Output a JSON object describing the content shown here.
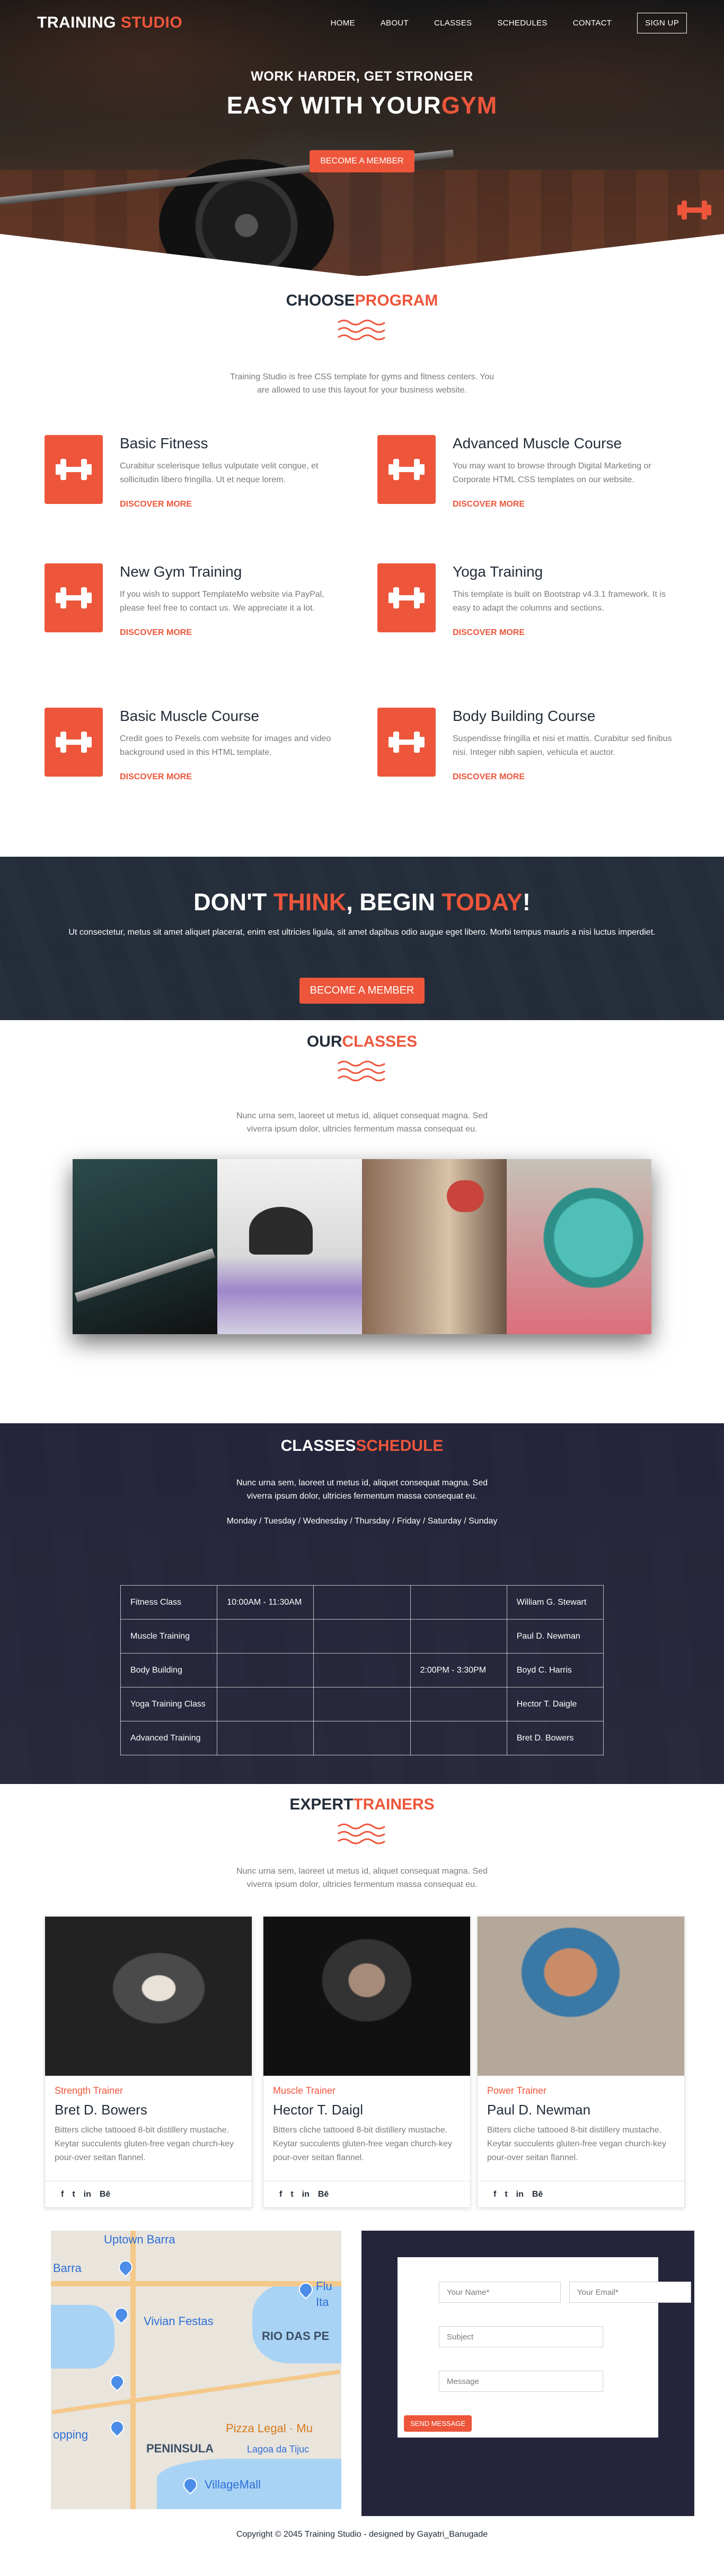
{
  "brand": {
    "name_part1": "TRAINING",
    "name_part2": "STUDIO"
  },
  "nav": {
    "items": [
      "HOME",
      "ABOUT",
      "CLASSES",
      "SCHEDULES",
      "CONTACT"
    ],
    "signup": "SIGN UP"
  },
  "hero": {
    "subtitle": "WORK HARDER, GET STRONGER",
    "title_part1": "EASY WITH YOUR",
    "title_part2": "GYM",
    "button": "BECOME A MEMBER"
  },
  "programs": {
    "title_part1": "CHOOSE",
    "title_part2": "PROGRAM",
    "desc": "Training Studio is free CSS template for gyms and fitness centers. You are allowed to use this layout for your business website.",
    "items": [
      {
        "title": "Basic Fitness",
        "text": "Curabitur scelerisque tellus vulputate velit congue, et sollicitudin libero fringilla. Ut et neque lorem.",
        "link": "DISCOVER MORE"
      },
      {
        "title": "Advanced Muscle Course",
        "text": "You may want to browse through Digital Marketing or Corporate HTML CSS templates on our website.",
        "link": "DISCOVER MORE"
      },
      {
        "title": "New Gym Training",
        "text": "If you wish to support TemplateMo website via PayPal, please feel free to contact us. We appreciate it a lot.",
        "link": "DISCOVER MORE"
      },
      {
        "title": "Yoga Training",
        "text": "This template is built on Bootstrap v4.3.1 framework. It is easy to adapt the columns and sections.",
        "link": "DISCOVER MORE"
      },
      {
        "title": "Basic Muscle Course",
        "text": "Credit goes to Pexels.com website for images and video background used in this HTML template.",
        "link": "DISCOVER MORE"
      },
      {
        "title": "Body Building Course",
        "text": "Suspendisse fringilla et nisi et mattis. Curabitur sed finibus nisi. Integer nibh sapien, vehicula et auctor.",
        "link": "DISCOVER MORE"
      }
    ]
  },
  "cta": {
    "title_a": "DON'T ",
    "title_b": "THINK",
    "title_c": ", BEGIN ",
    "title_d": "TODAY",
    "title_e": "!",
    "text": "Ut consectetur, metus sit amet aliquet placerat, enim est ultricies ligula, sit amet dapibus odio augue eget libero. Morbi tempus mauris a nisi luctus imperdiet.",
    "button": "BECOME A MEMBER"
  },
  "classes": {
    "title_part1": "OUR",
    "title_part2": "CLASSES",
    "desc": "Nunc urna sem, laoreet ut metus id, aliquet consequat magna. Sed viverra ipsum dolor, ultricies fermentum massa consequat eu."
  },
  "schedule": {
    "title_part1": "CLASSES",
    "title_part2": "SCHEDULE",
    "desc": "Nunc urna sem, laoreet ut metus id, aliquet consequat magna. Sed viverra ipsum dolor, ultricies fermentum massa consequat eu.",
    "days": "Monday / Tuesday / Wednesday / Thursday / Friday / Saturday / Sunday",
    "rows": [
      [
        "Fitness Class",
        "10:00AM - 11:30AM",
        "",
        "",
        "William G. Stewart"
      ],
      [
        "Muscle Training",
        "",
        "",
        "",
        "Paul D. Newman"
      ],
      [
        "Body Building",
        "",
        "",
        "2:00PM - 3:30PM",
        "Boyd C. Harris"
      ],
      [
        "Yoga Training Class",
        "",
        "",
        "",
        "Hector T. Daigle"
      ],
      [
        "Advanced Training",
        "",
        "",
        "",
        "Bret D. Bowers"
      ]
    ]
  },
  "trainers": {
    "title_part1": "EXPERT",
    "title_part2": "TRAINERS",
    "desc": "Nunc urna sem, laoreet ut metus id, aliquet consequat magna. Sed viverra ipsum dolor, ultricies fermentum massa consequat eu.",
    "items": [
      {
        "role": "Strength Trainer",
        "name": "Bret D. Bowers",
        "bio": "Bitters cliche tattooed 8-bit distillery mustache. Keytar succulents gluten-free vegan church-key pour-over seitan flannel."
      },
      {
        "role": "Muscle Trainer",
        "name": "Hector T. Daigl",
        "bio": "Bitters cliche tattooed 8-bit distillery mustache. Keytar succulents gluten-free vegan church-key pour-over seitan flannel."
      },
      {
        "role": "Power Trainer",
        "name": "Paul D. Newman",
        "bio": "Bitters cliche tattooed 8-bit distillery mustache. Keytar succulents gluten-free vegan church-key pour-over seitan flannel."
      }
    ],
    "social": [
      "f",
      "t",
      "in",
      "Bē"
    ]
  },
  "map": {
    "labels": [
      "Uptown Barra",
      "Barra",
      "Vivian Festas",
      "Flu",
      "Ita",
      "RIO DAS PE",
      "PENINSULA",
      "Pizza Legal · Mu",
      "Lagoa da Tijuc",
      "VillageMall",
      "opping"
    ]
  },
  "contact": {
    "name_placeholder": "Your Name*",
    "email_placeholder": "Your Email*",
    "subject_placeholder": "Subject",
    "message_placeholder": "Message",
    "send": "SEND MESSAGE"
  },
  "footer": {
    "text": "Copyright © 2045 Training Studio - designed by Gayatri_Banugade"
  },
  "colors": {
    "accent": "#ed563b",
    "dark": "#232d39"
  },
  "icons": {
    "program_icon": "dumbbell-icon",
    "hero_corner_icon": "dumbbell-icon"
  }
}
